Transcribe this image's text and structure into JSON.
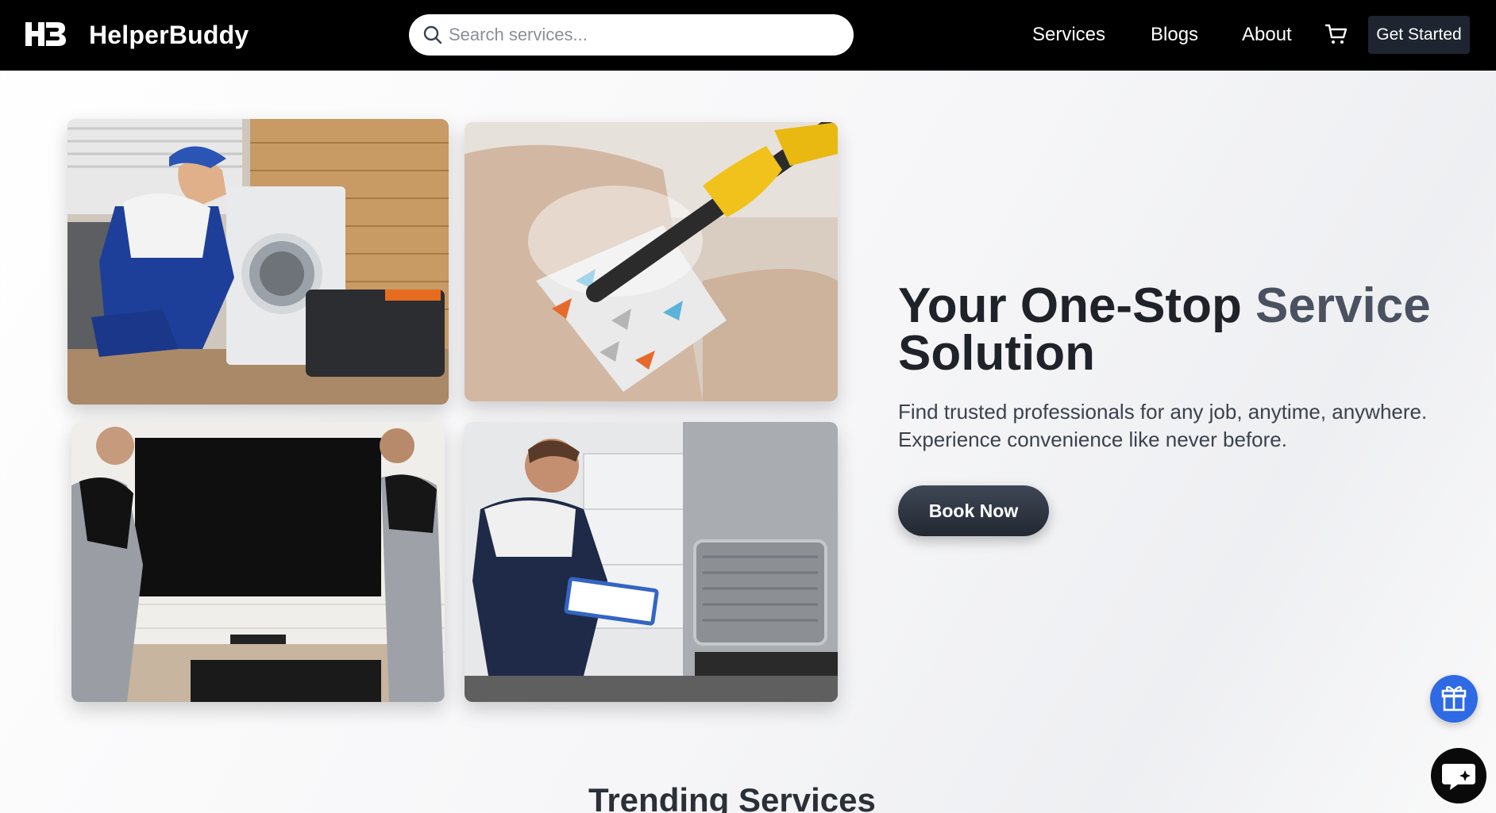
{
  "brand": {
    "name": "HelperBuddy",
    "logo_icon": "hb-logo-icon"
  },
  "search": {
    "placeholder": "Search services...",
    "value": ""
  },
  "nav": {
    "links": [
      "Services",
      "Blogs",
      "About"
    ],
    "cart_icon": "cart-icon",
    "cta_label": "Get Started"
  },
  "hero": {
    "title_part1": "Your One-Stop ",
    "title_accent": "Service",
    "title_part2": "Solution",
    "subtitle_line1": "Find trusted professionals for any job, anytime, anywhere.",
    "subtitle_line2": "Experience convenience like never before.",
    "button_label": "Book Now",
    "images": [
      "washing-machine-repair-photo",
      "sofa-steam-cleaning-photo",
      "tv-mounting-photo",
      "refrigerator-repair-photo"
    ]
  },
  "floating": {
    "gift_icon": "gift-icon",
    "chat_icon": "chat-icon"
  },
  "section": {
    "trending_title": "Trending Services"
  },
  "colors": {
    "nav_bg": "#000000",
    "accent_blue": "#2d6ae3",
    "button_dark": "#222831",
    "title_accent": "#4a5160"
  }
}
